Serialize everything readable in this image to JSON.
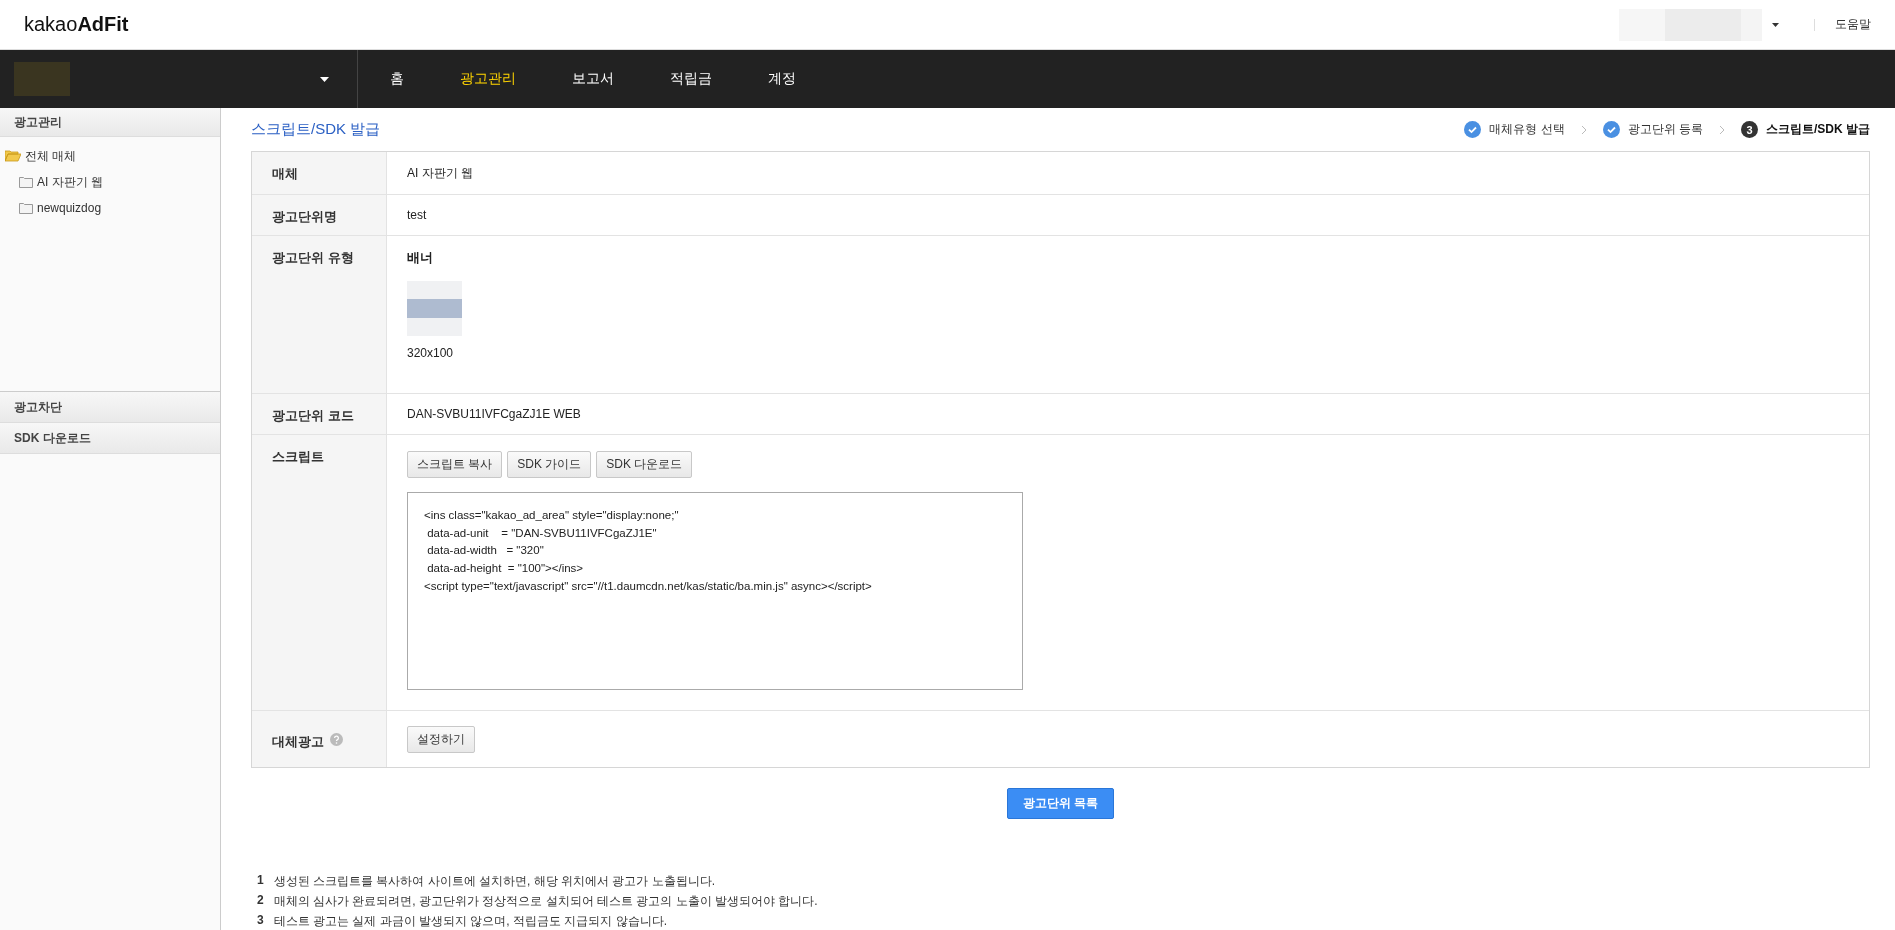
{
  "header": {
    "logo": "kakao**AdFit**",
    "help": "도움말"
  },
  "nav": {
    "items": [
      {
        "label": "홈",
        "selected": false
      },
      {
        "label": "광고관리",
        "selected": true
      },
      {
        "label": "보고서",
        "selected": false
      },
      {
        "label": "적립금",
        "selected": false
      },
      {
        "label": "계정",
        "selected": false
      }
    ]
  },
  "sidebar": {
    "sections": [
      {
        "title": "광고관리",
        "tree": [
          {
            "label": "전체 매체",
            "expanded": true,
            "children": [
              {
                "label": "AI 자판기 웹"
              },
              {
                "label": "newquizdog"
              }
            ]
          }
        ]
      },
      {
        "title": "광고차단"
      },
      {
        "title": "SDK 다운로드"
      }
    ]
  },
  "page": {
    "title": "스크립트/SDK 발급",
    "steps": [
      {
        "label": "매체유형 선택",
        "kind": "done"
      },
      {
        "label": "광고단위 등록",
        "kind": "done"
      },
      {
        "label": "스크립트/SDK 발급",
        "kind": "current",
        "number": "3"
      }
    ]
  },
  "form": [
    {
      "kind": "text",
      "label": "매체",
      "value": "AI 자판기 웹"
    },
    {
      "kind": "text",
      "label": "광고단위명",
      "value": "test"
    },
    {
      "kind": "banner",
      "label": "광고단위 유형",
      "value": "배너",
      "size": "320x100"
    },
    {
      "kind": "text",
      "label": "광고단위 코드",
      "value": "DAN-SVBU11IVFCgaZJ1E WEB"
    },
    {
      "kind": "script",
      "label": "스크립트",
      "buttons": [
        "스크립트 복사",
        "SDK 가이드",
        "SDK 다운로드"
      ],
      "code": "<ins class=\"kakao_ad_area\" style=\"display:none;\"\n data-ad-unit    = \"DAN-SVBU11IVFCgaZJ1E\"\n data-ad-width   = \"320\"\n data-ad-height  = \"100\"></ins>\n<script type=\"text/javascript\" src=\"//t1.daumcdn.net/kas/static/ba.min.js\" async></script>"
    },
    {
      "kind": "setting",
      "label": "대체광고",
      "help": true,
      "button": "설정하기"
    }
  ],
  "primary_button": "광고단위 목록",
  "notes": [
    {
      "number": "1",
      "text": "생성된 스크립트를 복사하여 사이트에 설치하면, 해당 위치에서 광고가 노출됩니다."
    },
    {
      "number": "2",
      "text": "매체의 심사가 완료되려면, 광고단위가 정상적으로 설치되어 테스트 광고의 노출이 발생되어야 합니다."
    },
    {
      "number": "3",
      "text": "테스트 광고는 실제 과금이 발생되지 않으며, 적립금도 지급되지 않습니다."
    }
  ]
}
